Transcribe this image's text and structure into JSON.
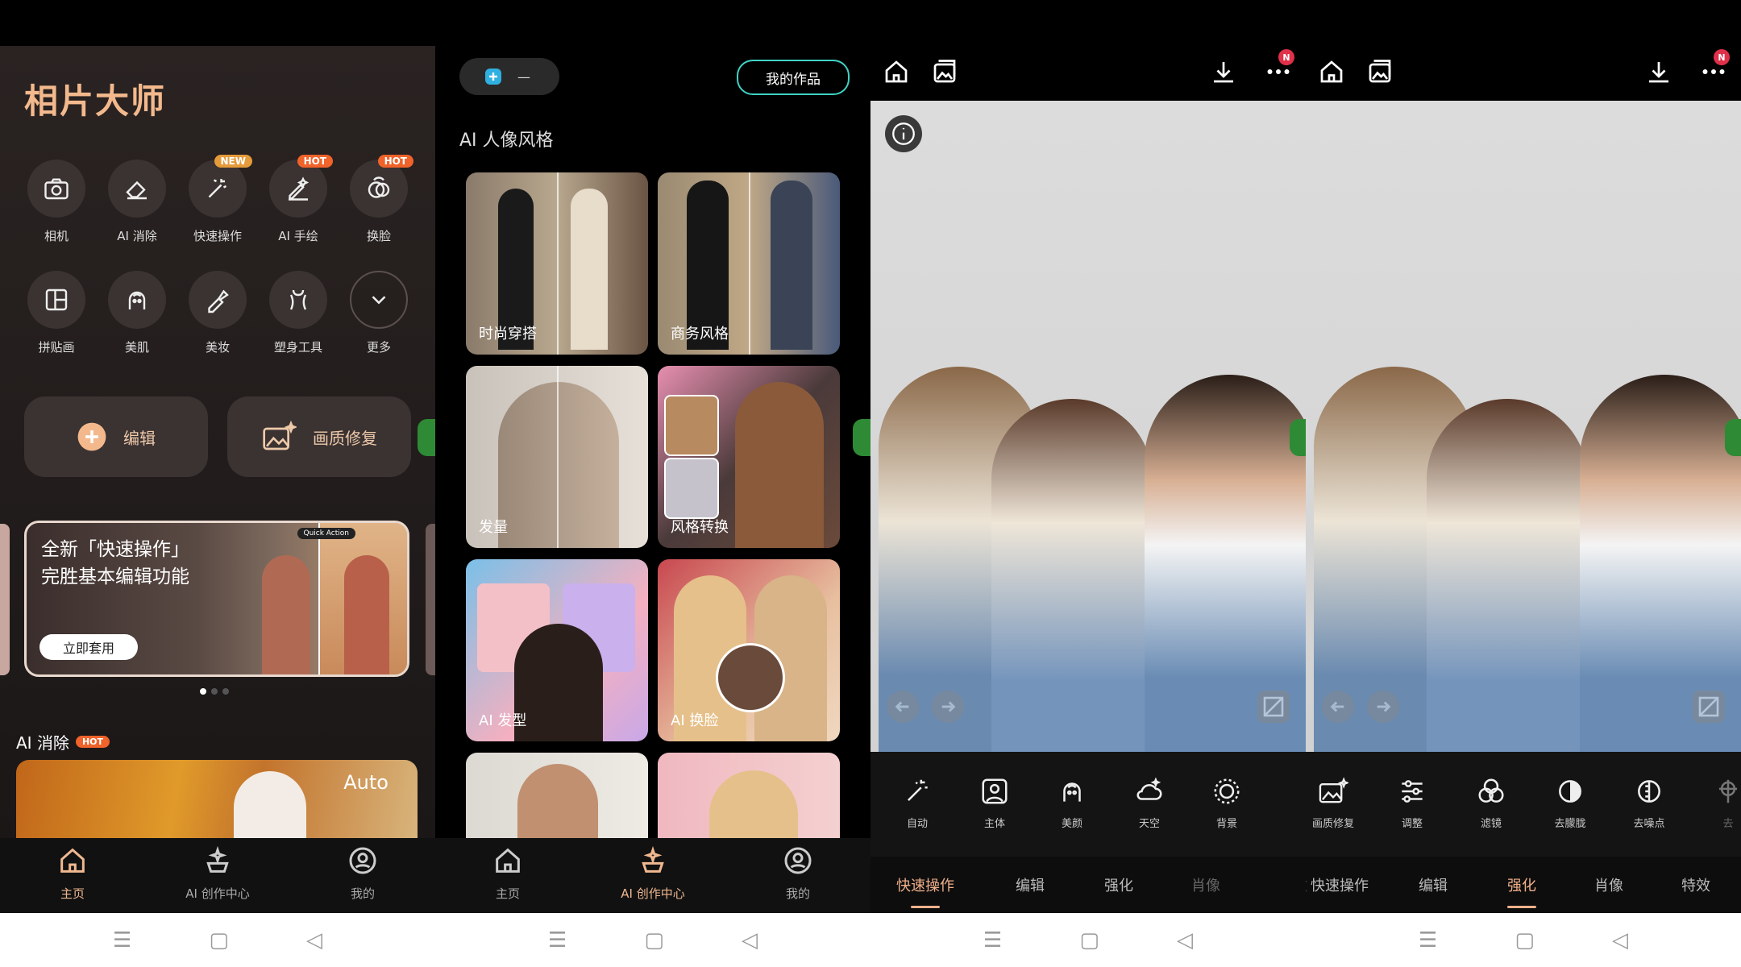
{
  "panel1": {
    "title": "相片大师",
    "tools": [
      {
        "label": "相机",
        "icon": "camera-icon",
        "badge": ""
      },
      {
        "label": "AI 消除",
        "icon": "eraser-icon",
        "badge": ""
      },
      {
        "label": "快速操作",
        "icon": "magic-wand-icon",
        "badge": "NEW"
      },
      {
        "label": "AI 手绘",
        "icon": "ai-draw-icon",
        "badge": "HOT"
      },
      {
        "label": "换脸",
        "icon": "face-swap-icon",
        "badge": "HOT"
      },
      {
        "label": "拼贴画",
        "icon": "collage-icon",
        "badge": ""
      },
      {
        "label": "美肌",
        "icon": "face-beauty-icon",
        "badge": ""
      },
      {
        "label": "美妆",
        "icon": "makeup-icon",
        "badge": ""
      },
      {
        "label": "塑身工具",
        "icon": "body-shape-icon",
        "badge": ""
      },
      {
        "label": "更多",
        "icon": "chevron-down-icon",
        "badge": ""
      }
    ],
    "edit_button": "编辑",
    "restore_button": "画质修复",
    "banner": {
      "line1": "全新「快速操作」",
      "line2": "完胜基本编辑功能",
      "quick_action": "Quick Action",
      "cta": "立即套用"
    },
    "section_title": "AI 消除",
    "section_badge": "HOT",
    "auto_label": "Auto"
  },
  "panel2": {
    "pill_text": "—",
    "my_works": "我的作品",
    "section_title": "AI 人像风格",
    "cards": [
      "时尚穿搭",
      "商务风格",
      "发量",
      "风格转换",
      "AI 发型",
      "AI 换脸"
    ]
  },
  "panel3": {
    "badge": "N",
    "tools": [
      {
        "label": "自动",
        "icon": "auto-wand-icon"
      },
      {
        "label": "主体",
        "icon": "subject-icon"
      },
      {
        "label": "美颜",
        "icon": "face-beauty-icon"
      },
      {
        "label": "天空",
        "icon": "sky-icon"
      },
      {
        "label": "背景",
        "icon": "background-icon"
      }
    ],
    "modes": [
      "快速操作",
      "编辑",
      "强化",
      "肖像"
    ],
    "active_mode": "快速操作"
  },
  "panel4": {
    "badge": "N",
    "tools": [
      {
        "label": "画质修复",
        "icon": "restore-icon"
      },
      {
        "label": "调整",
        "icon": "sliders-icon"
      },
      {
        "label": "滤镜",
        "icon": "filter-icon"
      },
      {
        "label": "去朦胧",
        "icon": "dehaze-icon"
      },
      {
        "label": "去噪点",
        "icon": "denoise-icon"
      },
      {
        "label": "去",
        "icon": "partial-icon"
      }
    ],
    "modes": [
      "特效",
      "快速操作",
      "编辑",
      "强化",
      "肖像",
      "特效"
    ],
    "active_mode": "强化"
  },
  "bottom_tabs": [
    "主页",
    "AI 创作中心",
    "我的"
  ],
  "colors": {
    "accent": "#f0b890",
    "teal": "#3fd2c4",
    "hot": "#f0632a",
    "new": "#e59b3a"
  }
}
